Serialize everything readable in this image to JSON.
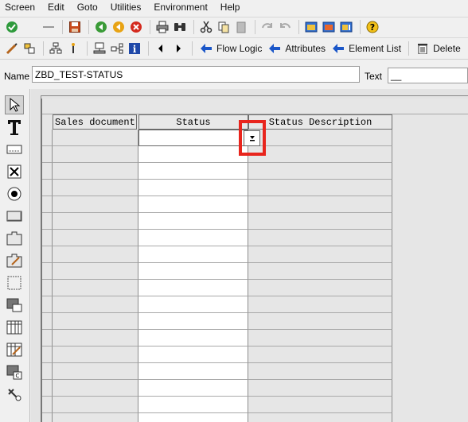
{
  "menu": [
    "Screen",
    "Edit",
    "Goto",
    "Utilities",
    "Environment",
    "Help"
  ],
  "toolbar2_buttons": {
    "flow_logic": "Flow Logic",
    "attributes": "Attributes",
    "element_list": "Element List",
    "delete": "Delete"
  },
  "fields": {
    "name_label": "Name",
    "name_value": "ZBD_TEST-STATUS",
    "text_label": "Text",
    "text_value": "__"
  },
  "table": {
    "columns": [
      "Sales document",
      "Status",
      "Status Description"
    ],
    "row_count": 18
  },
  "colors": {
    "highlight": "#e8251d",
    "arrow_blue": "#1a56c8"
  },
  "palette_icons": [
    "pointer-icon",
    "text-field-icon",
    "input-field-icon",
    "checkbox-icon",
    "radio-button-icon",
    "push-button-icon",
    "tabstrip-icon",
    "tabstrip-wizard-icon",
    "box-icon",
    "subscreen-icon",
    "table-control-icon",
    "table-wizard-icon",
    "custom-control-icon",
    "status-icon"
  ]
}
